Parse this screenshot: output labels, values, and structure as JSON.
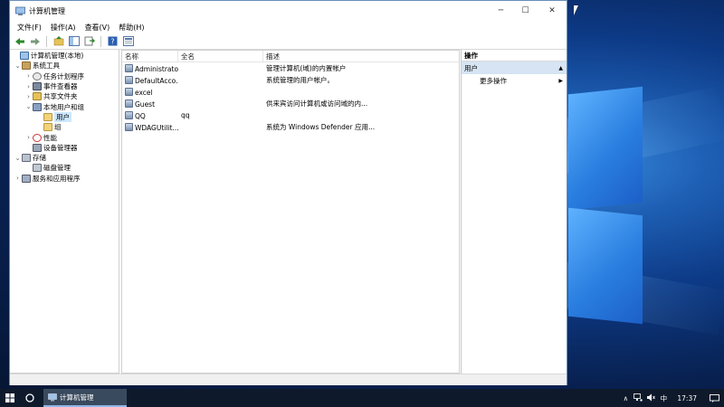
{
  "window": {
    "title": "计算机管理",
    "minimize_glyph": "─",
    "maximize_glyph": "☐",
    "close_glyph": "✕"
  },
  "menubar": {
    "file": "文件(F)",
    "action": "操作(A)",
    "view": "查看(V)",
    "help": "帮助(H)"
  },
  "toolbar": {
    "icons": [
      "back-icon",
      "forward-icon",
      "up-icon",
      "show-tree-icon",
      "export-icon",
      "help-icon",
      "properties-icon"
    ]
  },
  "tree": {
    "root": "计算机管理(本地)",
    "system_tools": "系统工具",
    "task_scheduler": "任务计划程序",
    "event_viewer": "事件查看器",
    "shared_folders": "共享文件夹",
    "local_users": "本地用户和组",
    "users": "用户",
    "groups": "组",
    "performance": "性能",
    "device_manager": "设备管理器",
    "storage": "存储",
    "disk_management": "磁盘管理",
    "services": "服务和应用程序"
  },
  "list": {
    "columns": [
      "名称",
      "全名",
      "描述"
    ],
    "rows": [
      {
        "name": "Administrator",
        "fullname": "",
        "desc": "管理计算机(域)的内置帐户"
      },
      {
        "name": "DefaultAcco...",
        "fullname": "",
        "desc": "系统管理的用户帐户。"
      },
      {
        "name": "excel",
        "fullname": "",
        "desc": ""
      },
      {
        "name": "Guest",
        "fullname": "",
        "desc": "供来宾访问计算机或访问域的内..."
      },
      {
        "name": "QQ",
        "fullname": "qq",
        "desc": ""
      },
      {
        "name": "WDAGUtilit...",
        "fullname": "",
        "desc": "系统为 Windows Defender 应用..."
      }
    ]
  },
  "actions": {
    "header": "操作",
    "section": "用户",
    "section_arrow": "▲",
    "more": "更多操作",
    "more_arrow": "▶"
  },
  "taskbar": {
    "task_label": "计算机管理",
    "tray_up": "∧",
    "ime": "中",
    "time": "17:37"
  },
  "colors": {
    "accent": "#0078d7",
    "selection": "#cce8ff",
    "taskbar": "#0e1a2b"
  }
}
